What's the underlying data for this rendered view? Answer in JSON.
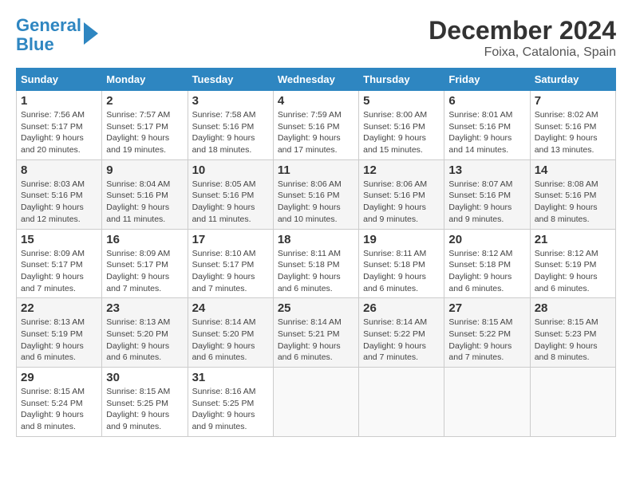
{
  "header": {
    "logo_line1": "General",
    "logo_line2": "Blue",
    "title": "December 2024",
    "subtitle": "Foixa, Catalonia, Spain"
  },
  "calendar": {
    "columns": [
      "Sunday",
      "Monday",
      "Tuesday",
      "Wednesday",
      "Thursday",
      "Friday",
      "Saturday"
    ],
    "weeks": [
      [
        {
          "day": "1",
          "sunrise": "7:56 AM",
          "sunset": "5:17 PM",
          "daylight": "9 hours and 20 minutes."
        },
        {
          "day": "2",
          "sunrise": "7:57 AM",
          "sunset": "5:17 PM",
          "daylight": "9 hours and 19 minutes."
        },
        {
          "day": "3",
          "sunrise": "7:58 AM",
          "sunset": "5:16 PM",
          "daylight": "9 hours and 18 minutes."
        },
        {
          "day": "4",
          "sunrise": "7:59 AM",
          "sunset": "5:16 PM",
          "daylight": "9 hours and 17 minutes."
        },
        {
          "day": "5",
          "sunrise": "8:00 AM",
          "sunset": "5:16 PM",
          "daylight": "9 hours and 15 minutes."
        },
        {
          "day": "6",
          "sunrise": "8:01 AM",
          "sunset": "5:16 PM",
          "daylight": "9 hours and 14 minutes."
        },
        {
          "day": "7",
          "sunrise": "8:02 AM",
          "sunset": "5:16 PM",
          "daylight": "9 hours and 13 minutes."
        }
      ],
      [
        {
          "day": "8",
          "sunrise": "8:03 AM",
          "sunset": "5:16 PM",
          "daylight": "9 hours and 12 minutes."
        },
        {
          "day": "9",
          "sunrise": "8:04 AM",
          "sunset": "5:16 PM",
          "daylight": "9 hours and 11 minutes."
        },
        {
          "day": "10",
          "sunrise": "8:05 AM",
          "sunset": "5:16 PM",
          "daylight": "9 hours and 11 minutes."
        },
        {
          "day": "11",
          "sunrise": "8:06 AM",
          "sunset": "5:16 PM",
          "daylight": "9 hours and 10 minutes."
        },
        {
          "day": "12",
          "sunrise": "8:06 AM",
          "sunset": "5:16 PM",
          "daylight": "9 hours and 9 minutes."
        },
        {
          "day": "13",
          "sunrise": "8:07 AM",
          "sunset": "5:16 PM",
          "daylight": "9 hours and 9 minutes."
        },
        {
          "day": "14",
          "sunrise": "8:08 AM",
          "sunset": "5:16 PM",
          "daylight": "9 hours and 8 minutes."
        }
      ],
      [
        {
          "day": "15",
          "sunrise": "8:09 AM",
          "sunset": "5:17 PM",
          "daylight": "9 hours and 7 minutes."
        },
        {
          "day": "16",
          "sunrise": "8:09 AM",
          "sunset": "5:17 PM",
          "daylight": "9 hours and 7 minutes."
        },
        {
          "day": "17",
          "sunrise": "8:10 AM",
          "sunset": "5:17 PM",
          "daylight": "9 hours and 7 minutes."
        },
        {
          "day": "18",
          "sunrise": "8:11 AM",
          "sunset": "5:18 PM",
          "daylight": "9 hours and 6 minutes."
        },
        {
          "day": "19",
          "sunrise": "8:11 AM",
          "sunset": "5:18 PM",
          "daylight": "9 hours and 6 minutes."
        },
        {
          "day": "20",
          "sunrise": "8:12 AM",
          "sunset": "5:18 PM",
          "daylight": "9 hours and 6 minutes."
        },
        {
          "day": "21",
          "sunrise": "8:12 AM",
          "sunset": "5:19 PM",
          "daylight": "9 hours and 6 minutes."
        }
      ],
      [
        {
          "day": "22",
          "sunrise": "8:13 AM",
          "sunset": "5:19 PM",
          "daylight": "9 hours and 6 minutes."
        },
        {
          "day": "23",
          "sunrise": "8:13 AM",
          "sunset": "5:20 PM",
          "daylight": "9 hours and 6 minutes."
        },
        {
          "day": "24",
          "sunrise": "8:14 AM",
          "sunset": "5:20 PM",
          "daylight": "9 hours and 6 minutes."
        },
        {
          "day": "25",
          "sunrise": "8:14 AM",
          "sunset": "5:21 PM",
          "daylight": "9 hours and 6 minutes."
        },
        {
          "day": "26",
          "sunrise": "8:14 AM",
          "sunset": "5:22 PM",
          "daylight": "9 hours and 7 minutes."
        },
        {
          "day": "27",
          "sunrise": "8:15 AM",
          "sunset": "5:22 PM",
          "daylight": "9 hours and 7 minutes."
        },
        {
          "day": "28",
          "sunrise": "8:15 AM",
          "sunset": "5:23 PM",
          "daylight": "9 hours and 8 minutes."
        }
      ],
      [
        {
          "day": "29",
          "sunrise": "8:15 AM",
          "sunset": "5:24 PM",
          "daylight": "9 hours and 8 minutes."
        },
        {
          "day": "30",
          "sunrise": "8:15 AM",
          "sunset": "5:25 PM",
          "daylight": "9 hours and 9 minutes."
        },
        {
          "day": "31",
          "sunrise": "8:16 AM",
          "sunset": "5:25 PM",
          "daylight": "9 hours and 9 minutes."
        },
        null,
        null,
        null,
        null
      ]
    ]
  }
}
